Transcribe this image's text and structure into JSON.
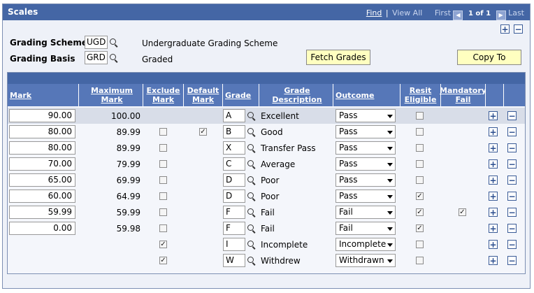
{
  "header": {
    "title": "Scales",
    "find": "Find",
    "separator": "|",
    "view_all": "View All",
    "first": "First",
    "page": "1 of 1",
    "last": "Last"
  },
  "form": {
    "grading_scheme_label": "Grading Scheme",
    "grading_scheme_code": "UGD",
    "grading_scheme_desc": "Undergraduate Grading Scheme",
    "grading_basis_label": "Grading Basis",
    "grading_basis_code": "GRD",
    "grading_basis_desc": "Graded",
    "fetch_grades": "Fetch Grades",
    "copy_to": "Copy To"
  },
  "columns": {
    "mark": "Mark",
    "max_mark": "Maximum Mark",
    "exclude_mark": "Exclude Mark",
    "default_mark": "Default Mark",
    "grade": "Grade",
    "grade_desc": "Grade Description",
    "outcome": "Outcome",
    "resit": "Resit Eligible",
    "mandatory": "Mandatory Fail"
  },
  "rows": [
    {
      "mark": "90.00",
      "max": "100.00",
      "exclude": false,
      "default": false,
      "grade": "A",
      "desc": "Excellent",
      "outcome": "Pass",
      "resit": false,
      "mandatory": false
    },
    {
      "mark": "80.00",
      "max": "89.99",
      "exclude": false,
      "default": true,
      "grade": "B",
      "desc": "Good",
      "outcome": "Pass",
      "resit": false,
      "mandatory": false
    },
    {
      "mark": "80.00",
      "max": "89.99",
      "exclude": false,
      "default": false,
      "grade": "X",
      "desc": "Transfer Pass",
      "outcome": "Pass",
      "resit": false,
      "mandatory": false
    },
    {
      "mark": "70.00",
      "max": "79.99",
      "exclude": false,
      "default": false,
      "grade": "C",
      "desc": "Average",
      "outcome": "Pass",
      "resit": false,
      "mandatory": false
    },
    {
      "mark": "65.00",
      "max": "69.99",
      "exclude": false,
      "default": false,
      "grade": "D",
      "desc": "Poor",
      "outcome": "Pass",
      "resit": false,
      "mandatory": false
    },
    {
      "mark": "60.00",
      "max": "64.99",
      "exclude": false,
      "default": false,
      "grade": "D",
      "desc": "Poor",
      "outcome": "Pass",
      "resit": true,
      "mandatory": false
    },
    {
      "mark": "59.99",
      "max": "59.99",
      "exclude": false,
      "default": false,
      "grade": "F",
      "desc": "Fail",
      "outcome": "Fail",
      "resit": true,
      "mandatory": true
    },
    {
      "mark": "0.00",
      "max": "59.98",
      "exclude": false,
      "default": false,
      "grade": "F",
      "desc": "Fail",
      "outcome": "Fail",
      "resit": true,
      "mandatory": false
    },
    {
      "mark": "",
      "max": "",
      "exclude": true,
      "default": false,
      "grade": "I",
      "desc": "Incomplete",
      "outcome": "Incomplete",
      "resit": false,
      "mandatory": false
    },
    {
      "mark": "",
      "max": "",
      "exclude": true,
      "default": false,
      "grade": "W",
      "desc": "Withdrew",
      "outcome": "Withdrawn",
      "resit": false,
      "mandatory": false
    }
  ],
  "icons": {
    "add": "+",
    "remove": "−",
    "check": "✓",
    "prev": "◀",
    "next": "▶"
  },
  "colors": {
    "header": "#4466a5",
    "column_header": "#5677b8",
    "button_yellow": "#ffffc0"
  }
}
